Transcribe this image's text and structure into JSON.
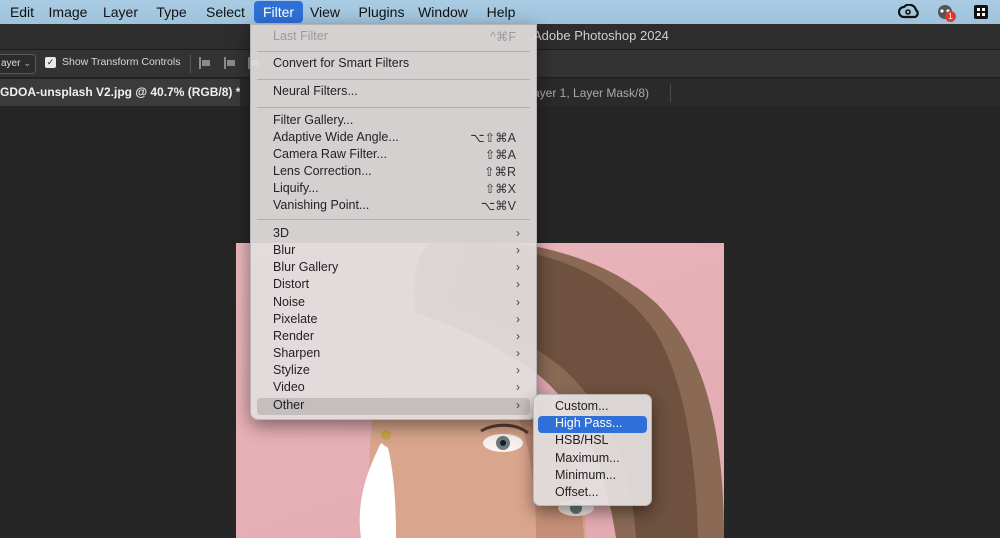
{
  "menubar": {
    "items": [
      "Edit",
      "Image",
      "Layer",
      "Type",
      "Select",
      "Filter",
      "View",
      "Plugins",
      "Window",
      "Help"
    ],
    "active": "Filter",
    "right_icons": [
      "creative-cloud-icon",
      "notification-icon",
      "control-center-icon"
    ],
    "badge": "1"
  },
  "titlebar": {
    "title": "Adobe Photoshop 2024"
  },
  "options_bar": {
    "layer_select": "ayer",
    "show_transform_controls": "Show Transform Controls",
    "show_transform_checked": true
  },
  "tabs": {
    "active_doc": "GDOA-unsplash V2.jpg @ 40.7% (RGB/8) *",
    "second_doc": "ayer 1, Layer Mask/8)"
  },
  "filter_menu": {
    "items": [
      {
        "label": "Last Filter",
        "shortcut": "^⌘F",
        "disabled": true
      },
      {
        "sep": true
      },
      {
        "label": "Convert for Smart Filters"
      },
      {
        "sep": true
      },
      {
        "label": "Neural Filters..."
      },
      {
        "sep": true
      },
      {
        "label": "Filter Gallery..."
      },
      {
        "label": "Adaptive Wide Angle...",
        "shortcut": "⌥⇧⌘A"
      },
      {
        "label": "Camera Raw Filter...",
        "shortcut": "⇧⌘A"
      },
      {
        "label": "Lens Correction...",
        "shortcut": "⇧⌘R"
      },
      {
        "label": "Liquify...",
        "shortcut": "⇧⌘X"
      },
      {
        "label": "Vanishing Point...",
        "shortcut": "⌥⌘V"
      },
      {
        "sep": true
      },
      {
        "label": "3D",
        "submenu": true
      },
      {
        "label": "Blur",
        "submenu": true
      },
      {
        "label": "Blur Gallery",
        "submenu": true
      },
      {
        "label": "Distort",
        "submenu": true
      },
      {
        "label": "Noise",
        "submenu": true
      },
      {
        "label": "Pixelate",
        "submenu": true
      },
      {
        "label": "Render",
        "submenu": true
      },
      {
        "label": "Sharpen",
        "submenu": true
      },
      {
        "label": "Stylize",
        "submenu": true
      },
      {
        "label": "Video",
        "submenu": true
      },
      {
        "label": "Other",
        "submenu": true,
        "highlighted": true
      }
    ]
  },
  "other_submenu": {
    "items": [
      "Custom...",
      "High Pass...",
      "HSB/HSL",
      "Maximum...",
      "Minimum...",
      "Offset..."
    ],
    "selected": "High Pass..."
  },
  "colors": {
    "menubar_bg": "#a9cbe3",
    "accent": "#2e6fd8",
    "photo_bg": "#e7b0b7",
    "app_bg": "#262626"
  }
}
